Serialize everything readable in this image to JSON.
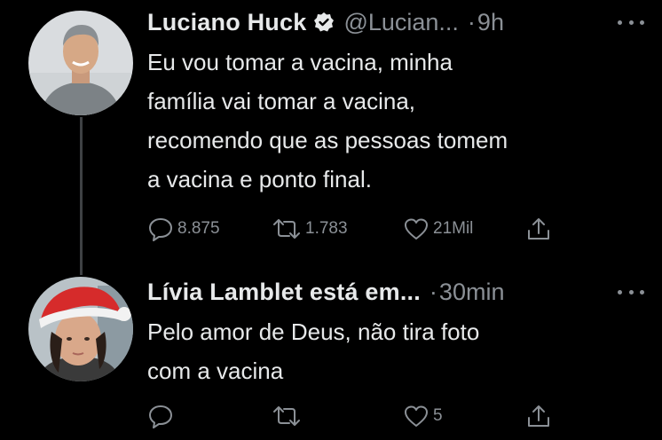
{
  "tweets": [
    {
      "name": "Luciano Huck",
      "handle": "@Lucian...",
      "separator": "·",
      "time": "9h",
      "text": "Eu vou tomar a vacina, minha\nfamília vai tomar a vacina,\nrecomendo que as pessoas tomem\na vacina e ponto final.",
      "replies": "8.875",
      "retweets": "1.783",
      "likes": "21Mil",
      "verified": true,
      "avatar_icon": "man-portrait-grey-shirt"
    },
    {
      "name": "Lívia Lamblet está em...",
      "separator": "·",
      "time": "30min",
      "text": "Pelo amor de Deus, não tira foto\ncom a vacina",
      "replies": "",
      "retweets": "",
      "likes": "5",
      "verified": false,
      "avatar_icon": "woman-portrait-santa-hat"
    }
  ],
  "colors": {
    "background": "#000000",
    "text": "#e7e9ea",
    "muted": "#8b9096",
    "thread_line": "#3e4144"
  }
}
